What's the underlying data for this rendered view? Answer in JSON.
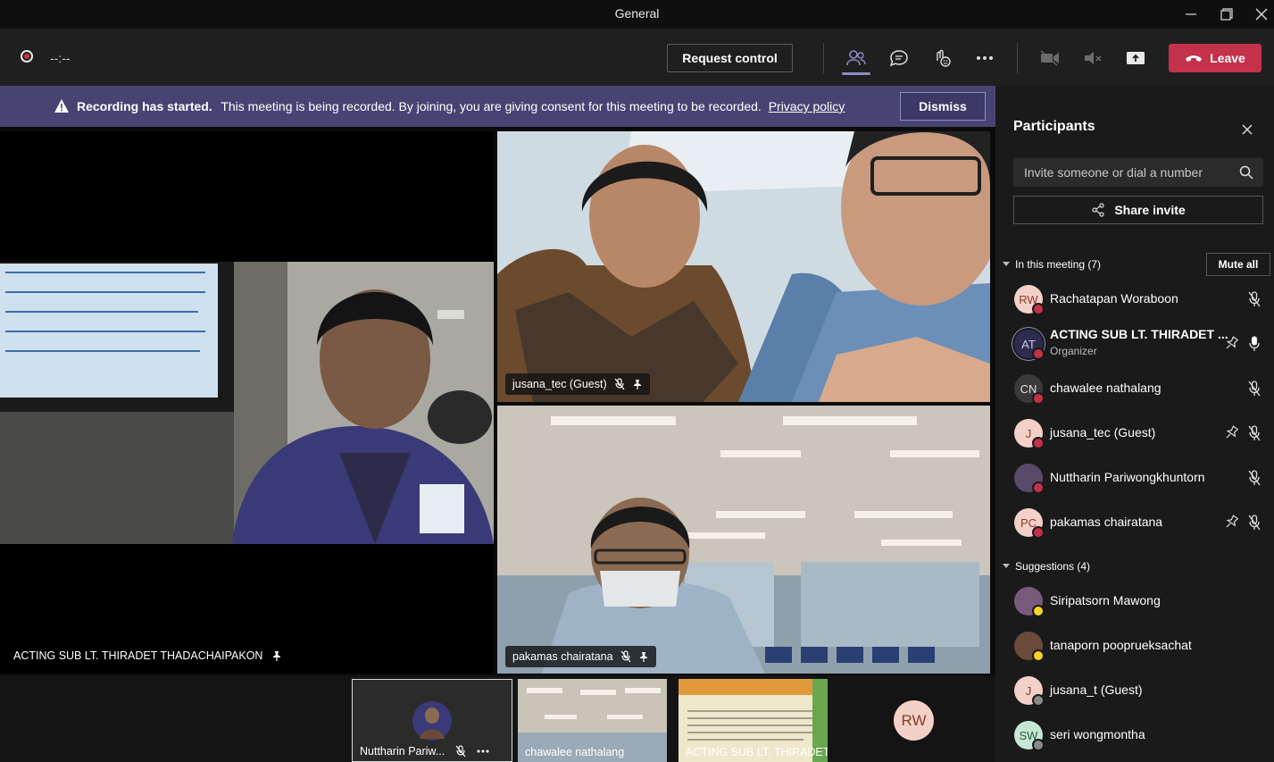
{
  "window": {
    "title": "General"
  },
  "toolbar": {
    "timer": "--:--",
    "request_control_label": "Request control",
    "leave_label": "Leave",
    "colors": {
      "leave": "#c4314b",
      "active_underline": "#8b8cc7"
    }
  },
  "banner": {
    "headline": "Recording has started.",
    "message": "This meeting is being recorded. By joining, you are giving consent for this meeting to be recorded.",
    "link_label": "Privacy policy",
    "dismiss_label": "Dismiss"
  },
  "stage": {
    "main_tile": {
      "name": "ACTING SUB LT. THIRADET THADACHAIPAKON"
    },
    "top_right_tile": {
      "name": "jusana_tec (Guest)"
    },
    "bottom_right_tile": {
      "name": "pakamas chairatana"
    }
  },
  "strip": {
    "thumbs": [
      {
        "name": "Nuttharin Pariw..."
      },
      {
        "name": "chawalee nathalang"
      },
      {
        "name": "ACTING SUB LT. THIRADET..."
      },
      {
        "initials": "RW"
      }
    ]
  },
  "sidebar": {
    "title": "Participants",
    "search_placeholder": "Invite someone or dial a number",
    "share_invite_label": "Share invite",
    "in_meeting_label": "In this meeting (7)",
    "mute_all_label": "Mute all",
    "participants": [
      {
        "initials": "RW",
        "name": "Rachatapan Woraboon",
        "avatar_color": "#f3d1c8",
        "text_color": "#8b3a2a",
        "status": "busy",
        "pinned": false,
        "mic": "muted"
      },
      {
        "initials": "AT",
        "name": "ACTING SUB LT. THIRADET ...",
        "role": "Organizer",
        "avatar_color": "#2d2c4e",
        "text_color": "#c9c8ef",
        "status": "busy",
        "pinned": true,
        "mic": "on"
      },
      {
        "initials": "CN",
        "name": "chawalee nathalang",
        "avatar_color": "#3a3a3a",
        "text_color": "#e0e0e0",
        "status": "busy",
        "pinned": false,
        "mic": "muted"
      },
      {
        "initials": "J",
        "name": "jusana_tec (Guest)",
        "avatar_color": "#f3d1c8",
        "text_color": "#8b3a2a",
        "status": "busy",
        "pinned": true,
        "mic": "muted"
      },
      {
        "initials": "",
        "name": "Nuttharin Pariwongkhuntorn",
        "avatar_color": "#5a4a6a",
        "text_color": "#fff",
        "status": "busy",
        "pinned": false,
        "mic": "muted"
      },
      {
        "initials": "PC",
        "name": "pakamas chairatana",
        "avatar_color": "#f3d1c8",
        "text_color": "#8b3a2a",
        "status": "busy",
        "pinned": true,
        "mic": "muted"
      }
    ],
    "suggestions_label": "Suggestions (4)",
    "suggestions": [
      {
        "initials": "",
        "name": "Siripatsorn Mawong",
        "avatar_color": "#7a5a7a",
        "text_color": "#fff",
        "status": "away"
      },
      {
        "initials": "",
        "name": "tanaporn pooprueksachat",
        "avatar_color": "#6a4a3a",
        "text_color": "#fff",
        "status": "away"
      },
      {
        "initials": "J",
        "name": "jusana_t (Guest)",
        "avatar_color": "#f3d1c8",
        "text_color": "#8b3a2a",
        "status": "offline"
      },
      {
        "initials": "SW",
        "name": "seri wongmontha",
        "avatar_color": "#c8e6d4",
        "text_color": "#2a5a3a",
        "status": "offline"
      }
    ]
  }
}
